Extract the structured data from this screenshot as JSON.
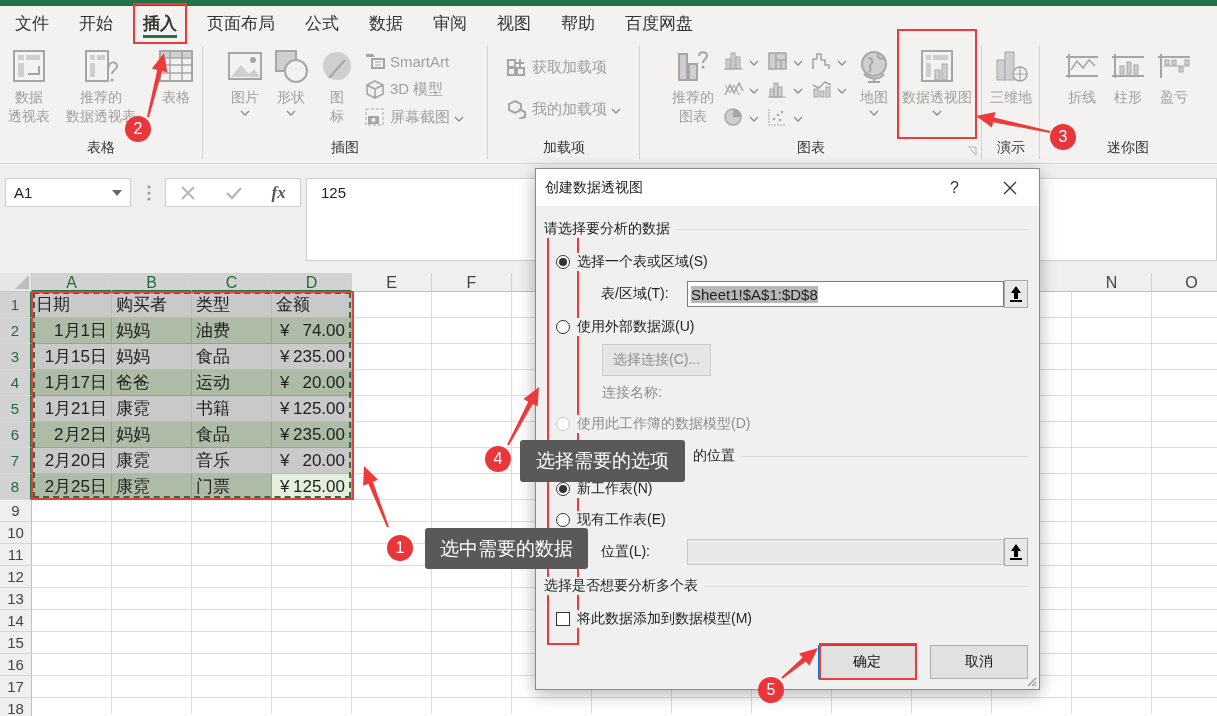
{
  "tabs": [
    {
      "label": "文件",
      "selected": false
    },
    {
      "label": "开始",
      "selected": false
    },
    {
      "label": "插入",
      "selected": true
    },
    {
      "label": "页面布局",
      "selected": false
    },
    {
      "label": "公式",
      "selected": false
    },
    {
      "label": "数据",
      "selected": false
    },
    {
      "label": "审阅",
      "selected": false
    },
    {
      "label": "视图",
      "selected": false
    },
    {
      "label": "帮助",
      "selected": false
    },
    {
      "label": "百度网盘",
      "selected": false
    }
  ],
  "ribbon": {
    "groups": [
      {
        "label": "表格",
        "launcher": false,
        "items": [
          {
            "kind": "large",
            "lines": [
              "数据",
              "透视表"
            ],
            "dropdown": false
          },
          {
            "kind": "large",
            "lines": [
              "推荐的",
              "数据透视表"
            ],
            "dropdown": false
          },
          {
            "kind": "large",
            "lines": [
              "表格"
            ],
            "dropdown": false
          }
        ]
      },
      {
        "label": "插图",
        "launcher": false,
        "items": [
          {
            "kind": "large",
            "lines": [
              "图片"
            ],
            "dropdown": true
          },
          {
            "kind": "large",
            "lines": [
              "形状"
            ],
            "dropdown": true
          },
          {
            "kind": "large",
            "lines": [
              "图",
              "标"
            ],
            "dropdown": false
          },
          {
            "kind": "stack",
            "items": [
              {
                "label": "SmartArt",
                "dropdown": false
              },
              {
                "label": "3D 模型",
                "dropdown": false
              },
              {
                "label": "屏幕截图",
                "dropdown": true
              }
            ]
          }
        ]
      },
      {
        "label": "加载项",
        "launcher": false,
        "items": [
          {
            "kind": "stack",
            "items": [
              {
                "label": "获取加载项",
                "dropdown": false
              },
              {
                "label": "我的加载项",
                "dropdown": true
              }
            ]
          }
        ]
      },
      {
        "label": "图表",
        "launcher": true,
        "items": [
          {
            "kind": "large",
            "lines": [
              "推荐的",
              "图表"
            ],
            "dropdown": false
          },
          {
            "kind": "stack",
            "items": [
              {
                "dropdown": true
              },
              {
                "dropdown": true
              },
              {
                "dropdown": true
              }
            ]
          },
          {
            "kind": "stack",
            "items": [
              {
                "dropdown": true
              },
              {
                "dropdown": true
              },
              {
                "dropdown": true
              }
            ]
          },
          {
            "kind": "stack",
            "items": [
              {
                "dropdown": true
              },
              {
                "dropdown": true
              }
            ]
          },
          {
            "kind": "large",
            "lines": [
              "地图"
            ],
            "dropdown": true
          },
          {
            "kind": "large",
            "lines": [
              "数据透视图"
            ],
            "dropdown": true
          }
        ]
      },
      {
        "label": "演示",
        "launcher": false,
        "items": [
          {
            "kind": "large",
            "lines": [
              "三维地"
            ],
            "dropdown": false
          }
        ]
      },
      {
        "label": "迷你图",
        "launcher": false,
        "items": [
          {
            "kind": "large",
            "lines": [
              "折线"
            ],
            "dropdown": false
          },
          {
            "kind": "large",
            "lines": [
              "柱形"
            ],
            "dropdown": false
          },
          {
            "kind": "large",
            "lines": [
              "盈亏"
            ],
            "dropdown": false
          }
        ]
      }
    ]
  },
  "formula_bar": {
    "name_box": "A1",
    "function_label": "fx",
    "formula": "125"
  },
  "sheet": {
    "columns_left": [
      {
        "label": "A",
        "selected": true
      },
      {
        "label": "B",
        "selected": true
      },
      {
        "label": "C",
        "selected": true
      },
      {
        "label": "D",
        "selected": true
      },
      {
        "label": "E",
        "selected": false
      },
      {
        "label": "F",
        "selected": false
      }
    ],
    "columns_right": [
      {
        "label": "N",
        "selected": false
      },
      {
        "label": "O",
        "selected": false
      }
    ],
    "rows": [
      {
        "number": "1",
        "selected": true,
        "cells": [
          {
            "kind": "text",
            "text": "日期",
            "active": false
          },
          {
            "kind": "text",
            "text": "购买者",
            "active": false
          },
          {
            "kind": "text",
            "text": "类型",
            "active": false
          },
          {
            "kind": "text",
            "text": "金额",
            "active": false
          }
        ]
      },
      {
        "number": "2",
        "selected": true,
        "cells": [
          {
            "kind": "date",
            "text": "1月1日",
            "active": false
          },
          {
            "kind": "text",
            "text": "妈妈",
            "active": false
          },
          {
            "kind": "text",
            "text": "油费",
            "active": false
          },
          {
            "kind": "money",
            "symbol": "¥",
            "text": "74.00",
            "active": false
          }
        ]
      },
      {
        "number": "3",
        "selected": true,
        "cells": [
          {
            "kind": "date",
            "text": "1月15日",
            "active": false
          },
          {
            "kind": "text",
            "text": "妈妈",
            "active": false
          },
          {
            "kind": "text",
            "text": "食品",
            "active": false
          },
          {
            "kind": "money",
            "symbol": "¥",
            "text": "235.00",
            "active": false
          }
        ]
      },
      {
        "number": "4",
        "selected": true,
        "cells": [
          {
            "kind": "date",
            "text": "1月17日",
            "active": false
          },
          {
            "kind": "text",
            "text": "爸爸",
            "active": false
          },
          {
            "kind": "text",
            "text": "运动",
            "active": false
          },
          {
            "kind": "money",
            "symbol": "¥",
            "text": "20.00",
            "active": false
          }
        ]
      },
      {
        "number": "5",
        "selected": true,
        "cells": [
          {
            "kind": "date",
            "text": "1月21日",
            "active": false
          },
          {
            "kind": "text",
            "text": "康霓",
            "active": false
          },
          {
            "kind": "text",
            "text": "书籍",
            "active": false
          },
          {
            "kind": "money",
            "symbol": "¥",
            "text": "125.00",
            "active": false
          }
        ]
      },
      {
        "number": "6",
        "selected": true,
        "cells": [
          {
            "kind": "date",
            "text": "2月2日",
            "active": false
          },
          {
            "kind": "text",
            "text": "妈妈",
            "active": false
          },
          {
            "kind": "text",
            "text": "食品",
            "active": false
          },
          {
            "kind": "money",
            "symbol": "¥",
            "text": "235.00",
            "active": false
          }
        ]
      },
      {
        "number": "7",
        "selected": true,
        "cells": [
          {
            "kind": "date",
            "text": "2月20日",
            "active": false
          },
          {
            "kind": "text",
            "text": "康霓",
            "active": false
          },
          {
            "kind": "text",
            "text": "音乐",
            "active": false
          },
          {
            "kind": "money",
            "symbol": "¥",
            "text": "20.00",
            "active": false
          }
        ]
      },
      {
        "number": "8",
        "selected": true,
        "cells": [
          {
            "kind": "date",
            "text": "2月25日",
            "active": false
          },
          {
            "kind": "text",
            "text": "康霓",
            "active": false
          },
          {
            "kind": "text",
            "text": "门票",
            "active": false
          },
          {
            "kind": "money",
            "symbol": "¥",
            "text": "125.00",
            "active": true
          }
        ]
      },
      {
        "number": "9",
        "selected": false
      },
      {
        "number": "10",
        "selected": false
      },
      {
        "number": "11",
        "selected": false
      },
      {
        "number": "12",
        "selected": false
      },
      {
        "number": "13",
        "selected": false
      },
      {
        "number": "14",
        "selected": false
      },
      {
        "number": "15",
        "selected": false
      },
      {
        "number": "16",
        "selected": false
      },
      {
        "number": "17",
        "selected": false
      },
      {
        "number": "18",
        "selected": false
      }
    ]
  },
  "dialog": {
    "title": "创建数据透视图",
    "help": "?",
    "rows": [
      {
        "kind": "heading",
        "text": "请选择要分析的数据",
        "covered": false
      },
      {
        "kind": "radio",
        "label": "选择一个表或区域(S)",
        "selected": true,
        "disabled": false
      },
      {
        "kind": "field",
        "label": "表/区域(T):",
        "value": "Sheet1!$A$1:$D$8",
        "highlighted": true,
        "disabled": false
      },
      {
        "kind": "radio",
        "label": "使用外部数据源(U)",
        "selected": false,
        "disabled": false
      },
      {
        "kind": "button",
        "label": "选择连接(C)...",
        "disabled": true
      },
      {
        "kind": "note",
        "text": "连接名称:",
        "disabled": true
      },
      {
        "kind": "radio",
        "label": "使用此工作簿的数据模型(D)",
        "selected": false,
        "disabled": true
      },
      {
        "kind": "heading",
        "text": "的位置",
        "covered": true
      },
      {
        "kind": "radio",
        "label": "新工作表(N)",
        "selected": true,
        "disabled": false
      },
      {
        "kind": "radio",
        "label": "现有工作表(E)",
        "selected": false,
        "disabled": false
      },
      {
        "kind": "field",
        "label": "位置(L):",
        "disabled": true
      },
      {
        "kind": "heading",
        "text": "选择是否想要分析多个表",
        "covered": false
      },
      {
        "kind": "checkbox",
        "label": "将此数据添加到数据模型(M)",
        "checked": false
      }
    ],
    "buttons": [
      {
        "label": "确定",
        "default": true
      },
      {
        "label": "取消",
        "default": false
      }
    ]
  },
  "annotations": [
    {
      "number": "1",
      "text": "选中需要的数据"
    },
    {
      "number": "2"
    },
    {
      "number": "3"
    },
    {
      "number": "4",
      "text": "选择需要的选项"
    },
    {
      "number": "5"
    }
  ]
}
